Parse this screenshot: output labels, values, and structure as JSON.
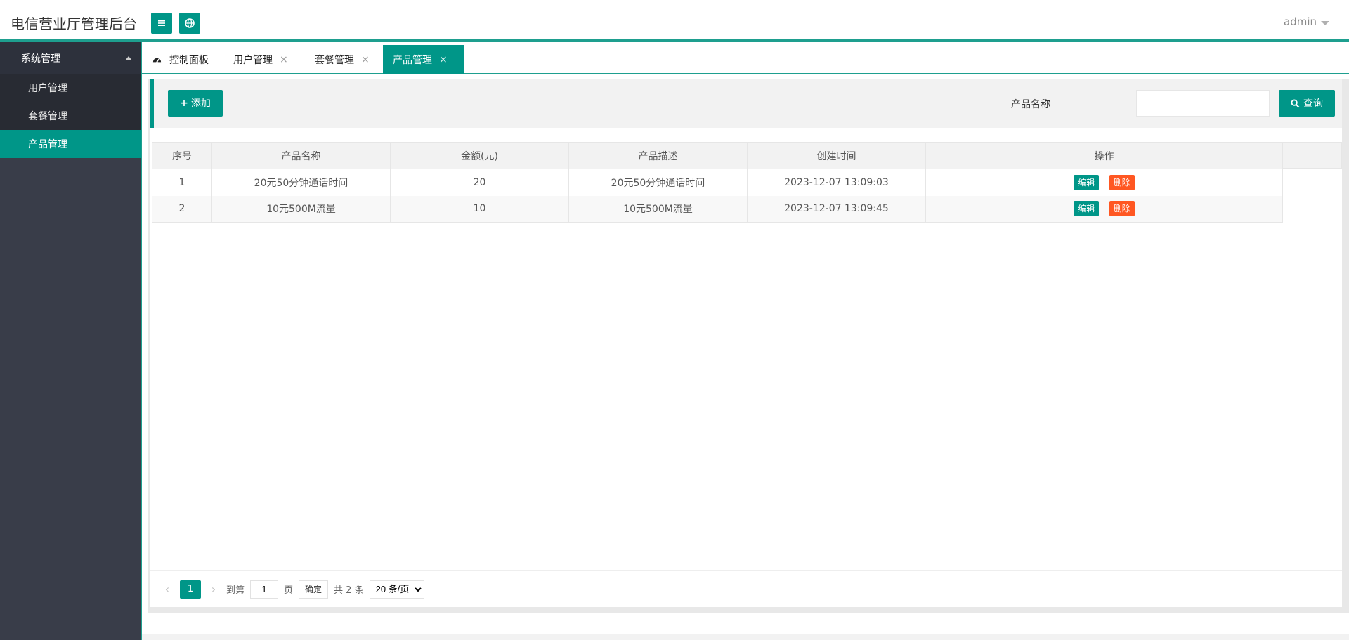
{
  "header": {
    "title": "电信营业厅管理后台",
    "user": "admin",
    "menu_icon": "menu-icon",
    "globe_icon": "globe-icon"
  },
  "sidebar": {
    "group": "系统管理",
    "items": [
      {
        "label": "用户管理"
      },
      {
        "label": "套餐管理"
      },
      {
        "label": "产品管理"
      }
    ]
  },
  "tabs": [
    {
      "label": "控制面板",
      "icon": "dashboard-icon"
    },
    {
      "label": "用户管理",
      "close": "×"
    },
    {
      "label": "套餐管理",
      "close": "×"
    },
    {
      "label": "产品管理",
      "close": "×"
    }
  ],
  "toolbar": {
    "add_label": "添加",
    "search_label": "产品名称",
    "search_value": "",
    "query_label": "查询"
  },
  "table": {
    "columns": [
      "序号",
      "产品名称",
      "金额(元)",
      "产品描述",
      "创建时间",
      "操作"
    ],
    "rows": [
      [
        "1",
        "20元50分钟通话时间",
        "20",
        "20元50分钟通话时间",
        "2023-12-07 13:09:03"
      ],
      [
        "2",
        "10元500M流量",
        "10",
        "10元500M流量",
        "2023-12-07 13:09:45"
      ]
    ],
    "edit_label": "编辑",
    "delete_label": "删除"
  },
  "pager": {
    "current_page": "1",
    "goto_prefix": "到第",
    "goto_value": "1",
    "goto_suffix": "页",
    "confirm_label": "确定",
    "total": "共 2 条",
    "page_size": "20 条/页"
  },
  "colors": {
    "accent": "#009688",
    "danger": "#ff5722",
    "sidebar": "#393d49"
  }
}
